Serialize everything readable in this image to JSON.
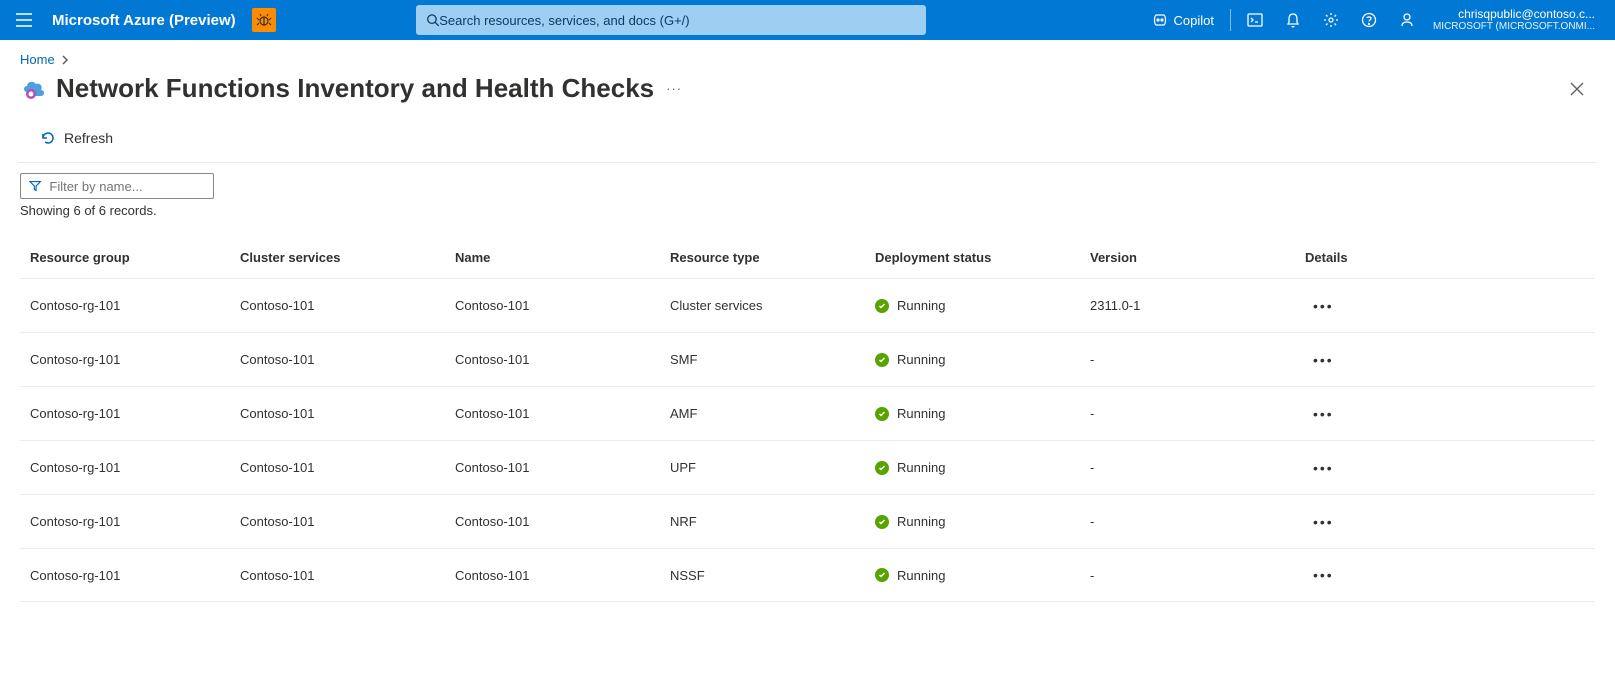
{
  "topbar": {
    "brand": "Microsoft Azure (Preview)",
    "search_placeholder": "Search resources, services, and docs (G+/)",
    "copilot": "Copilot",
    "account_email": "chrisqpublic@contoso.c...",
    "account_tenant": "MICROSOFT (MICROSOFT.ONMI..."
  },
  "breadcrumb": {
    "home": "Home"
  },
  "page": {
    "title": "Network Functions Inventory and Health Checks",
    "more": "···"
  },
  "toolbar": {
    "refresh": "Refresh"
  },
  "filter": {
    "placeholder": "Filter by name...",
    "records": "Showing 6 of 6 records."
  },
  "table": {
    "headers": {
      "resource_group": "Resource group",
      "cluster_services": "Cluster services",
      "name": "Name",
      "resource_type": "Resource type",
      "deployment_status": "Deployment status",
      "version": "Version",
      "details": "Details"
    },
    "rows": [
      {
        "rg": "Contoso-rg-101",
        "cs": "Contoso-101",
        "name": "Contoso-101",
        "type": "Cluster services",
        "status": "Running",
        "version": "2311.0-1"
      },
      {
        "rg": "Contoso-rg-101",
        "cs": "Contoso-101",
        "name": "Contoso-101",
        "type": "SMF",
        "status": "Running",
        "version": "-"
      },
      {
        "rg": "Contoso-rg-101",
        "cs": "Contoso-101",
        "name": "Contoso-101",
        "type": "AMF",
        "status": "Running",
        "version": "-"
      },
      {
        "rg": "Contoso-rg-101",
        "cs": "Contoso-101",
        "name": "Contoso-101",
        "type": "UPF",
        "status": "Running",
        "version": "-"
      },
      {
        "rg": "Contoso-rg-101",
        "cs": "Contoso-101",
        "name": "Contoso-101",
        "type": "NRF",
        "status": "Running",
        "version": "-"
      },
      {
        "rg": "Contoso-rg-101",
        "cs": "Contoso-101",
        "name": "Contoso-101",
        "type": "NSSF",
        "status": "Running",
        "version": "-"
      }
    ]
  }
}
